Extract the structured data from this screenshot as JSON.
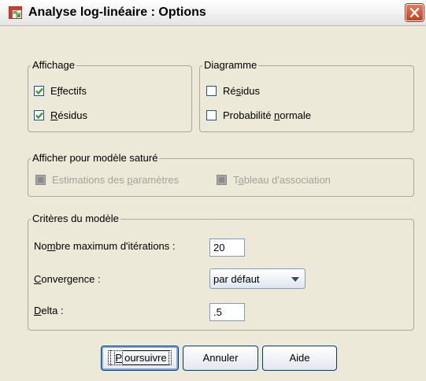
{
  "window": {
    "title": "Analyse log-linéaire : Options"
  },
  "groups": {
    "affichage": {
      "label": "Affichage",
      "items": [
        {
          "pre": "E",
          "u": "f",
          "post": "fectifs",
          "checked": true
        },
        {
          "pre": "",
          "u": "R",
          "post": "ésidus",
          "checked": true
        }
      ]
    },
    "diagramme": {
      "label": "Diagramme",
      "items": [
        {
          "pre": "Ré",
          "u": "s",
          "post": "idus",
          "checked": false
        },
        {
          "pre": "Probabilité ",
          "u": "n",
          "post": "ormale",
          "checked": false
        }
      ]
    },
    "sature": {
      "label": "Afficher pour modèle saturé",
      "items": [
        {
          "pre": "Estimations des ",
          "u": "p",
          "post": "aramètres",
          "enabled": false
        },
        {
          "pre": "T",
          "u": "a",
          "post": "bleau d'association",
          "enabled": false
        }
      ]
    },
    "criteres": {
      "label": "Critères du modèle",
      "iterations": {
        "pre": "No",
        "u": "m",
        "post": "bre maximum d'itérations :",
        "value": "20"
      },
      "convergence": {
        "pre": "",
        "u": "C",
        "post": "onvergence :",
        "value": "par défaut"
      },
      "delta": {
        "pre": "",
        "u": "D",
        "post": "elta :",
        "value": ".5"
      }
    }
  },
  "buttons": {
    "poursuivre": {
      "pre": "",
      "u": "P",
      "post": "oursuivre"
    },
    "annuler": {
      "label": "Annuler"
    },
    "aide": {
      "label": "Aide"
    }
  }
}
